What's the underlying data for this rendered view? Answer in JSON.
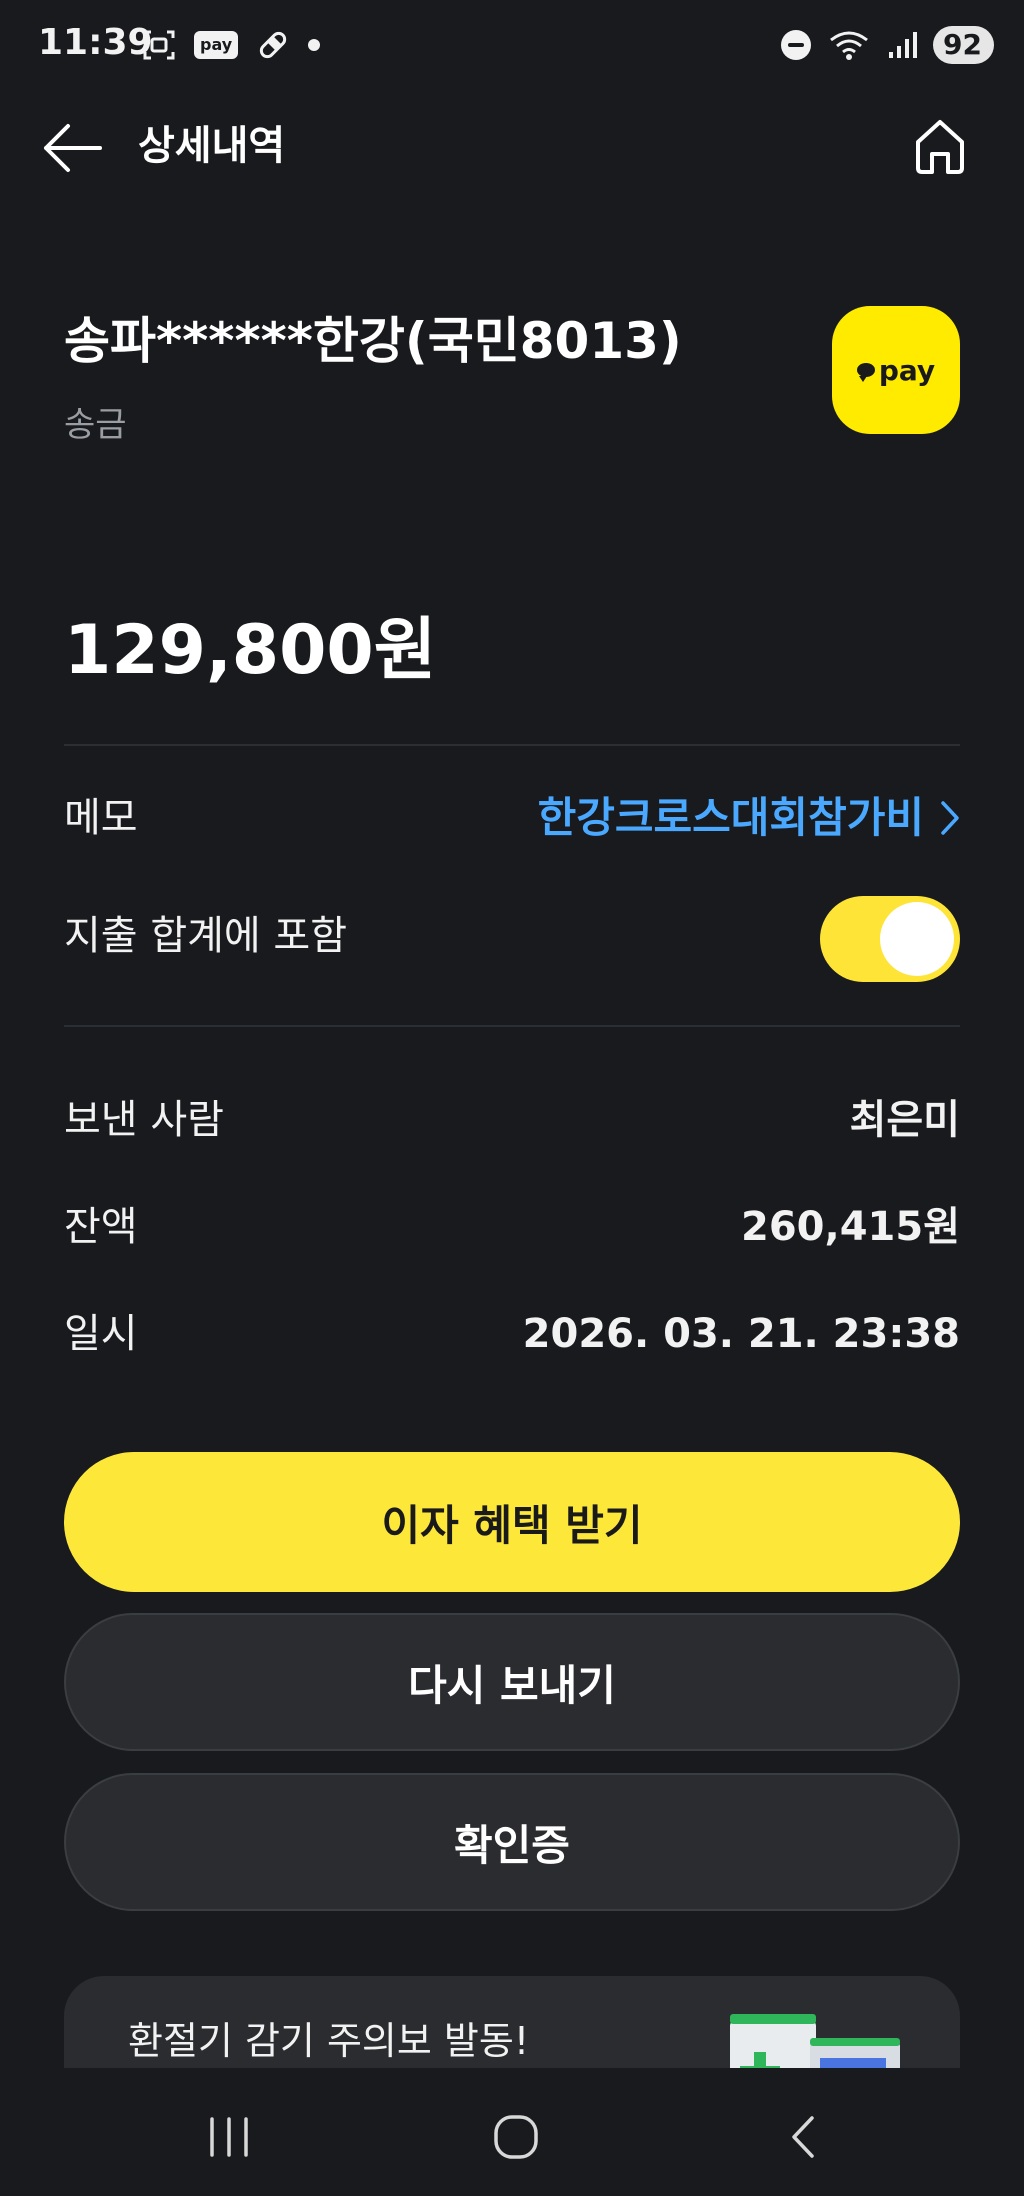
{
  "status_bar": {
    "time": "11:39",
    "pay_icon_label": "pay",
    "battery": "92"
  },
  "header": {
    "title": "상세내역",
    "back_icon": "arrow-left-icon",
    "home_icon": "home-icon"
  },
  "transaction": {
    "recipient": "송파******한강(국민8013)",
    "type": "송금",
    "logo_text": "pay",
    "amount": "129,800원"
  },
  "memo": {
    "label": "메모",
    "value": "한강크로스대회참가비"
  },
  "expense_toggle": {
    "label": "지출 합계에 포함",
    "on": true,
    "color": "#fde437"
  },
  "details": [
    {
      "label": "보낸 사람",
      "value": "최은미"
    },
    {
      "label": "잔액",
      "value": "260,415원"
    },
    {
      "label": "일시",
      "value": "2026. 03. 21. 23:38"
    }
  ],
  "buttons": {
    "interest": "이자 혜택 받기",
    "resend": "다시 보내기",
    "certificate": "확인증"
  },
  "banner": {
    "text": "환절기 감기 주의보 발동!"
  },
  "colors": {
    "background": "#181a1d",
    "accent_yellow": "#fde83a",
    "link_blue": "#4aa8ff"
  }
}
